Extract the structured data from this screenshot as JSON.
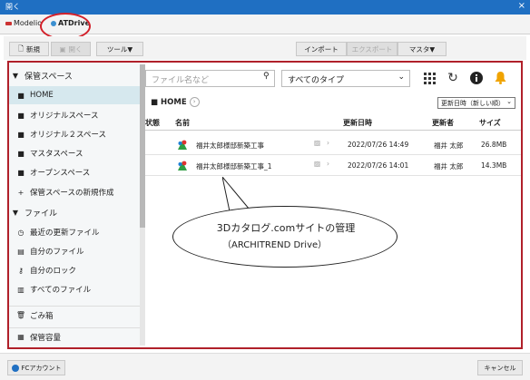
{
  "window": {
    "title": "開く",
    "close": "×"
  },
  "tabs": [
    {
      "label": "Modelio"
    },
    {
      "label": "ATDrive"
    }
  ],
  "toolbar": {
    "new_label": "新規",
    "open_label": "開く",
    "tools_label": "ツール▼",
    "import_label": "インポート",
    "export_label": "エクスポート",
    "master_label": "マスタ▼"
  },
  "sidebar": {
    "items": [
      {
        "icon": "▼",
        "label": "保管スペース"
      },
      {
        "icon": "■",
        "label": "HOME"
      },
      {
        "icon": "■",
        "label": "オリジナルスペース"
      },
      {
        "icon": "■",
        "label": "オリジナル２スペース"
      },
      {
        "icon": "■",
        "label": "マスタスペース"
      },
      {
        "icon": "■",
        "label": "オープンスペース"
      },
      {
        "icon": "+",
        "label": "保管スペースの新規作成"
      },
      {
        "icon": "▼",
        "label": "ファイル"
      },
      {
        "icon": "◷",
        "label": "最近の更新ファイル"
      },
      {
        "icon": "▤",
        "label": "自分のファイル"
      },
      {
        "icon": "⚷",
        "label": "自分のロック"
      },
      {
        "icon": "▥",
        "label": "すべてのファイル"
      },
      {
        "icon": "🗑",
        "label": "ごみ箱"
      },
      {
        "icon": "▦",
        "label": "保管容量"
      }
    ]
  },
  "search": {
    "placeholder": "ファイル名など"
  },
  "filter": {
    "type_selected": "すべてのタイプ"
  },
  "breadcrumb": {
    "label": "HOME"
  },
  "sort": {
    "selected": "更新日時（新しい順）"
  },
  "table": {
    "headers": [
      "状態",
      "名前",
      "更新日時",
      "更新者",
      "サイズ"
    ],
    "rows": [
      {
        "name": "福井太郎様邸新築工事",
        "date": "2022/07/26 14:49",
        "user": "福井 太郎",
        "size": "26.8MB"
      },
      {
        "name": "福井太郎様邸新築工事_1",
        "date": "2022/07/26 14:01",
        "user": "福井 太郎",
        "size": "14.3MB"
      }
    ]
  },
  "callout": {
    "line1": "3Dカタログ.comサイトの管理",
    "line2": "（ARCHITREND Drive）"
  },
  "footer": {
    "account_label": "FCアカウント",
    "cancel_label": "キャンセル"
  },
  "colors": {
    "titlebar": "#1f6fc2",
    "highlight_ring": "#d3202a",
    "main_border": "#b0202a",
    "sidebar_selected": "#d6e8ee",
    "bell": "#f0a300"
  }
}
